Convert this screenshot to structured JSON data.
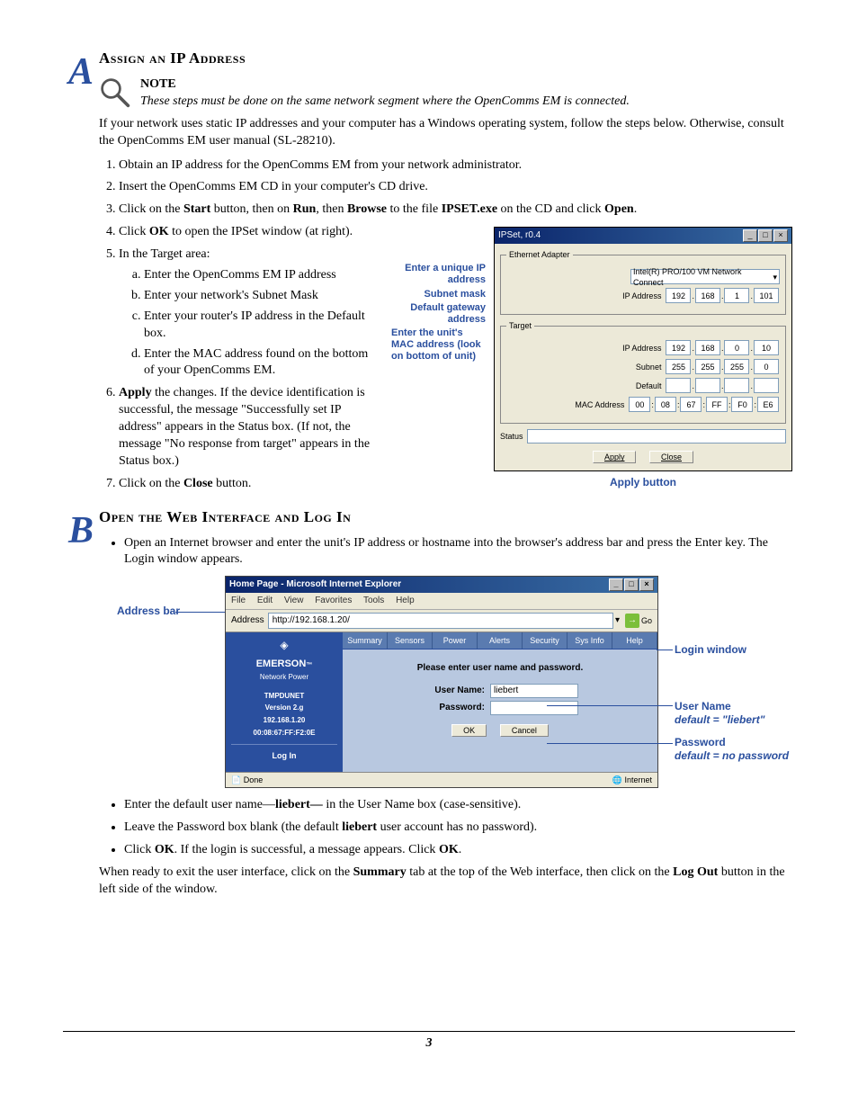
{
  "page_number": "3",
  "sectionA": {
    "letter": "A",
    "title": "Assign an IP Address",
    "note_title": "NOTE",
    "note_text": "These steps must be done on the same network segment where the OpenComms EM is connected.",
    "intro": "If your network uses static IP addresses and your computer has a Windows operating system, follow the steps below. Otherwise, consult the OpenComms EM user manual (SL-28210).",
    "steps": {
      "s1": "Obtain an IP address for the OpenComms EM from your network administrator.",
      "s2": "Insert the OpenComms EM CD in your computer's CD drive.",
      "s3_a": "Click on the ",
      "s3_b": "Start",
      "s3_c": " button, then on ",
      "s3_d": "Run",
      "s3_e": ", then ",
      "s3_f": "Browse",
      "s3_g": " to the file ",
      "s3_h": "IPSET.exe",
      "s3_i": " on the CD and click ",
      "s3_j": "Open",
      "s3_k": ".",
      "s4_a": "Click ",
      "s4_b": "OK",
      "s4_c": " to open the IPSet window (at right).",
      "s5": "In the Target area:",
      "s5a": "Enter the OpenComms EM IP address",
      "s5b": "Enter your network's Subnet Mask",
      "s5c": "Enter your router's IP address in the Default box.",
      "s5d": "Enter the MAC address found on the bottom of your OpenComms EM.",
      "s6_a": "Apply",
      "s6_b": " the changes. If the device identification is successful, the message \"Successfully set IP address\" appears in the Status box. (If not, the message \"No response from target\" appears in the Status box.)",
      "s7_a": "Click on the ",
      "s7_b": "Close",
      "s7_c": " button."
    },
    "callouts": {
      "ip": "Enter a unique IP address",
      "subnet": "Subnet mask",
      "gateway": "Default gateway address",
      "mac": "Enter the unit's MAC address (look on bottom of unit)",
      "apply": "Apply button"
    },
    "ipset": {
      "title": "IPSet, r0.4",
      "eth_legend": "Ethernet Adapter",
      "eth_value": "Intel(R) PRO/100 VM Network Connect",
      "eth_ip_label": "IP Address",
      "eth_ip": [
        "192",
        "168",
        "1",
        "101"
      ],
      "tgt_legend": "Target",
      "tgt_ip_label": "IP Address",
      "tgt_ip": [
        "192",
        "168",
        "0",
        "10"
      ],
      "subnet_label": "Subnet",
      "subnet": [
        "255",
        "255",
        "255",
        "0"
      ],
      "default_label": "Default",
      "default": [
        "",
        "",
        "",
        ""
      ],
      "mac_label": "MAC Address",
      "mac": [
        "00",
        "08",
        "67",
        "FF",
        "F0",
        "E6"
      ],
      "status_label": "Status",
      "apply_btn": "Apply",
      "close_btn": "Close"
    }
  },
  "sectionB": {
    "letter": "B",
    "title": "Open the Web Interface and Log In",
    "bullet1": "Open an Internet browser and enter the unit's IP address or hostname into the browser's address bar and press the Enter key. The Login window appears.",
    "callouts": {
      "addressbar": "Address bar",
      "loginwin": "Login window",
      "username": "User Name",
      "username_def": "default = \"liebert\"",
      "password": "Password",
      "password_def": "default = no password"
    },
    "browser": {
      "title": "Home Page - Microsoft Internet Explorer",
      "menu": [
        "File",
        "Edit",
        "View",
        "Favorites",
        "Tools",
        "Help"
      ],
      "addr_label": "Address",
      "addr_value": "http://192.168.1.20/",
      "go": "Go",
      "logo": "EMERSON",
      "logo_sub": "Network Power",
      "side_line1": "TMPDUNET",
      "side_line2": "Version 2.g",
      "side_line3": "192.168.1.20",
      "side_line4": "00:08:67:FF:F2:0E",
      "side_login": "Log In",
      "tabs": [
        "Summary",
        "Sensors",
        "Power",
        "Alerts",
        "Security",
        "Sys Info",
        "Help"
      ],
      "prompt": "Please enter user name and password.",
      "user_label": "User Name:",
      "user_value": "liebert",
      "pass_label": "Password:",
      "ok": "OK",
      "cancel": "Cancel",
      "status_left": "Done",
      "status_right": "Internet"
    },
    "post": {
      "b2_a": "Enter the default user name—",
      "b2_b": "liebert—",
      "b2_c": " in the User Name box (case-sensitive).",
      "b3_a": "Leave the Password box blank (the default ",
      "b3_b": "liebert",
      "b3_c": " user account has no password).",
      "b4_a": "Click ",
      "b4_b": "OK",
      "b4_c": ". If the login is successful, a message appears. Click ",
      "b4_d": "OK",
      "b4_e": ".",
      "p_a": "When ready to exit the user interface, click on the ",
      "p_b": "Summary",
      "p_c": " tab at the top of the Web interface, then click on the ",
      "p_d": "Log Out",
      "p_e": " button in the left side of the window."
    }
  }
}
